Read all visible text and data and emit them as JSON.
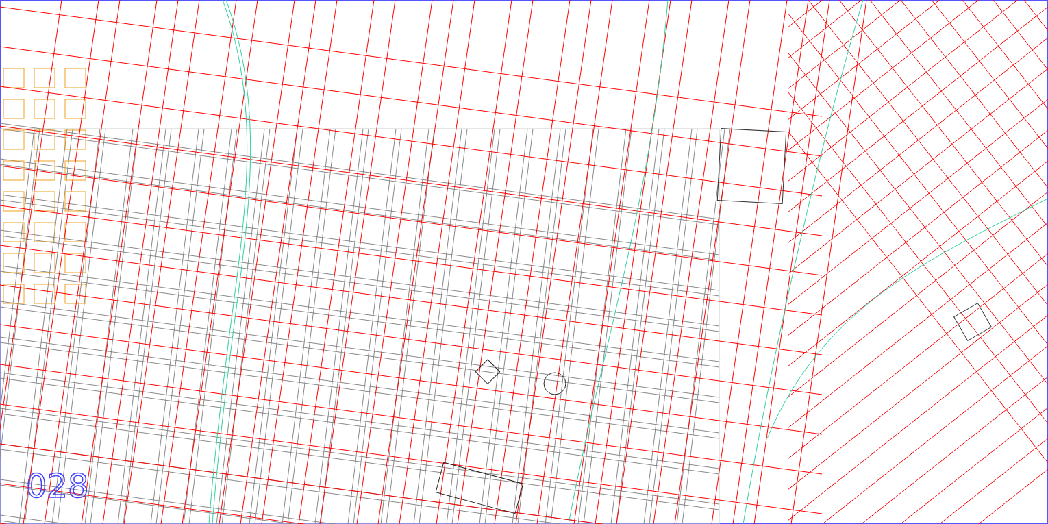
{
  "map": {
    "sheet_label": "028"
  }
}
